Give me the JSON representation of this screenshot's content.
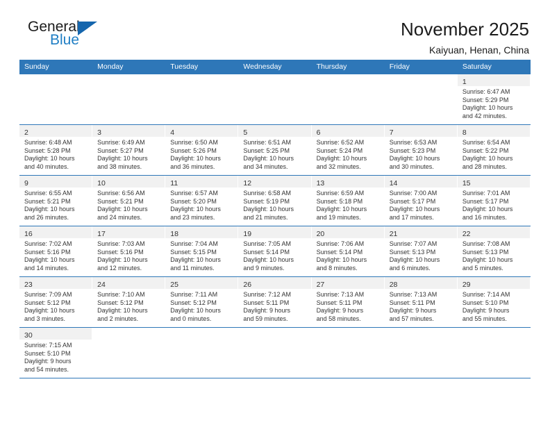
{
  "brand": {
    "name_line1": "General",
    "name_line2": "Blue",
    "accent_color": "#1f7ec4",
    "triangle_color": "#1566ad"
  },
  "header": {
    "title": "November 2025",
    "subtitle": "Kaiyuan, Henan, China"
  },
  "theme": {
    "header_row_bg": "#2e77b8",
    "daynum_band_bg": "#f1f1f1",
    "row_separator": "#2e77b8",
    "text": "#333333"
  },
  "weekdays": [
    "Sunday",
    "Monday",
    "Tuesday",
    "Wednesday",
    "Thursday",
    "Friday",
    "Saturday"
  ],
  "weeks": [
    [
      {
        "day": "",
        "empty": true
      },
      {
        "day": "",
        "empty": true
      },
      {
        "day": "",
        "empty": true
      },
      {
        "day": "",
        "empty": true
      },
      {
        "day": "",
        "empty": true
      },
      {
        "day": "",
        "empty": true
      },
      {
        "day": "1",
        "sunrise": "Sunrise: 6:47 AM",
        "sunset": "Sunset: 5:29 PM",
        "daylight1": "Daylight: 10 hours",
        "daylight2": "and 42 minutes."
      }
    ],
    [
      {
        "day": "2",
        "sunrise": "Sunrise: 6:48 AM",
        "sunset": "Sunset: 5:28 PM",
        "daylight1": "Daylight: 10 hours",
        "daylight2": "and 40 minutes."
      },
      {
        "day": "3",
        "sunrise": "Sunrise: 6:49 AM",
        "sunset": "Sunset: 5:27 PM",
        "daylight1": "Daylight: 10 hours",
        "daylight2": "and 38 minutes."
      },
      {
        "day": "4",
        "sunrise": "Sunrise: 6:50 AM",
        "sunset": "Sunset: 5:26 PM",
        "daylight1": "Daylight: 10 hours",
        "daylight2": "and 36 minutes."
      },
      {
        "day": "5",
        "sunrise": "Sunrise: 6:51 AM",
        "sunset": "Sunset: 5:25 PM",
        "daylight1": "Daylight: 10 hours",
        "daylight2": "and 34 minutes."
      },
      {
        "day": "6",
        "sunrise": "Sunrise: 6:52 AM",
        "sunset": "Sunset: 5:24 PM",
        "daylight1": "Daylight: 10 hours",
        "daylight2": "and 32 minutes."
      },
      {
        "day": "7",
        "sunrise": "Sunrise: 6:53 AM",
        "sunset": "Sunset: 5:23 PM",
        "daylight1": "Daylight: 10 hours",
        "daylight2": "and 30 minutes."
      },
      {
        "day": "8",
        "sunrise": "Sunrise: 6:54 AM",
        "sunset": "Sunset: 5:22 PM",
        "daylight1": "Daylight: 10 hours",
        "daylight2": "and 28 minutes."
      }
    ],
    [
      {
        "day": "9",
        "sunrise": "Sunrise: 6:55 AM",
        "sunset": "Sunset: 5:21 PM",
        "daylight1": "Daylight: 10 hours",
        "daylight2": "and 26 minutes."
      },
      {
        "day": "10",
        "sunrise": "Sunrise: 6:56 AM",
        "sunset": "Sunset: 5:21 PM",
        "daylight1": "Daylight: 10 hours",
        "daylight2": "and 24 minutes."
      },
      {
        "day": "11",
        "sunrise": "Sunrise: 6:57 AM",
        "sunset": "Sunset: 5:20 PM",
        "daylight1": "Daylight: 10 hours",
        "daylight2": "and 23 minutes."
      },
      {
        "day": "12",
        "sunrise": "Sunrise: 6:58 AM",
        "sunset": "Sunset: 5:19 PM",
        "daylight1": "Daylight: 10 hours",
        "daylight2": "and 21 minutes."
      },
      {
        "day": "13",
        "sunrise": "Sunrise: 6:59 AM",
        "sunset": "Sunset: 5:18 PM",
        "daylight1": "Daylight: 10 hours",
        "daylight2": "and 19 minutes."
      },
      {
        "day": "14",
        "sunrise": "Sunrise: 7:00 AM",
        "sunset": "Sunset: 5:17 PM",
        "daylight1": "Daylight: 10 hours",
        "daylight2": "and 17 minutes."
      },
      {
        "day": "15",
        "sunrise": "Sunrise: 7:01 AM",
        "sunset": "Sunset: 5:17 PM",
        "daylight1": "Daylight: 10 hours",
        "daylight2": "and 16 minutes."
      }
    ],
    [
      {
        "day": "16",
        "sunrise": "Sunrise: 7:02 AM",
        "sunset": "Sunset: 5:16 PM",
        "daylight1": "Daylight: 10 hours",
        "daylight2": "and 14 minutes."
      },
      {
        "day": "17",
        "sunrise": "Sunrise: 7:03 AM",
        "sunset": "Sunset: 5:16 PM",
        "daylight1": "Daylight: 10 hours",
        "daylight2": "and 12 minutes."
      },
      {
        "day": "18",
        "sunrise": "Sunrise: 7:04 AM",
        "sunset": "Sunset: 5:15 PM",
        "daylight1": "Daylight: 10 hours",
        "daylight2": "and 11 minutes."
      },
      {
        "day": "19",
        "sunrise": "Sunrise: 7:05 AM",
        "sunset": "Sunset: 5:14 PM",
        "daylight1": "Daylight: 10 hours",
        "daylight2": "and 9 minutes."
      },
      {
        "day": "20",
        "sunrise": "Sunrise: 7:06 AM",
        "sunset": "Sunset: 5:14 PM",
        "daylight1": "Daylight: 10 hours",
        "daylight2": "and 8 minutes."
      },
      {
        "day": "21",
        "sunrise": "Sunrise: 7:07 AM",
        "sunset": "Sunset: 5:13 PM",
        "daylight1": "Daylight: 10 hours",
        "daylight2": "and 6 minutes."
      },
      {
        "day": "22",
        "sunrise": "Sunrise: 7:08 AM",
        "sunset": "Sunset: 5:13 PM",
        "daylight1": "Daylight: 10 hours",
        "daylight2": "and 5 minutes."
      }
    ],
    [
      {
        "day": "23",
        "sunrise": "Sunrise: 7:09 AM",
        "sunset": "Sunset: 5:12 PM",
        "daylight1": "Daylight: 10 hours",
        "daylight2": "and 3 minutes."
      },
      {
        "day": "24",
        "sunrise": "Sunrise: 7:10 AM",
        "sunset": "Sunset: 5:12 PM",
        "daylight1": "Daylight: 10 hours",
        "daylight2": "and 2 minutes."
      },
      {
        "day": "25",
        "sunrise": "Sunrise: 7:11 AM",
        "sunset": "Sunset: 5:12 PM",
        "daylight1": "Daylight: 10 hours",
        "daylight2": "and 0 minutes."
      },
      {
        "day": "26",
        "sunrise": "Sunrise: 7:12 AM",
        "sunset": "Sunset: 5:11 PM",
        "daylight1": "Daylight: 9 hours",
        "daylight2": "and 59 minutes."
      },
      {
        "day": "27",
        "sunrise": "Sunrise: 7:13 AM",
        "sunset": "Sunset: 5:11 PM",
        "daylight1": "Daylight: 9 hours",
        "daylight2": "and 58 minutes."
      },
      {
        "day": "28",
        "sunrise": "Sunrise: 7:13 AM",
        "sunset": "Sunset: 5:11 PM",
        "daylight1": "Daylight: 9 hours",
        "daylight2": "and 57 minutes."
      },
      {
        "day": "29",
        "sunrise": "Sunrise: 7:14 AM",
        "sunset": "Sunset: 5:10 PM",
        "daylight1": "Daylight: 9 hours",
        "daylight2": "and 55 minutes."
      }
    ],
    [
      {
        "day": "30",
        "sunrise": "Sunrise: 7:15 AM",
        "sunset": "Sunset: 5:10 PM",
        "daylight1": "Daylight: 9 hours",
        "daylight2": "and 54 minutes."
      },
      {
        "day": "",
        "empty": true
      },
      {
        "day": "",
        "empty": true
      },
      {
        "day": "",
        "empty": true
      },
      {
        "day": "",
        "empty": true
      },
      {
        "day": "",
        "empty": true
      },
      {
        "day": "",
        "empty": true
      }
    ]
  ]
}
